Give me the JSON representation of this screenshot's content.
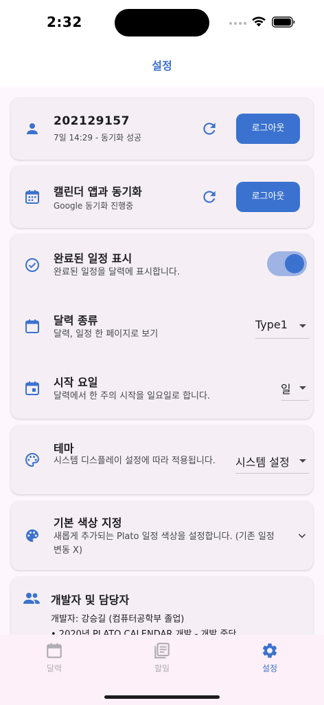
{
  "status_bar": {
    "time": "2:32"
  },
  "app_bar": {
    "title": "설정"
  },
  "account": {
    "id": "202129157",
    "sync_status": "7일 14:29 - 동기화 성공",
    "logout_label": "로그아웃",
    "icon": "person-icon"
  },
  "calendar_sync": {
    "title": "캘린더 앱과 동기화",
    "status": "Google 동기화 진행중",
    "logout_label": "로그아웃",
    "icon": "calendar-icon"
  },
  "settings": {
    "show_completed": {
      "title": "완료된 일정 표시",
      "desc": "완료된 일정을 달력에 표시합니다.",
      "enabled": true
    },
    "calendar_type": {
      "title": "달력 종류",
      "desc": "달력, 일정 한 페이지로 보기",
      "value": "Type1"
    },
    "start_day": {
      "title": "시작 요일",
      "desc": "달력에서 한 주의 시작을 일요일로 합니다.",
      "value": "일"
    }
  },
  "theme": {
    "title": "테마",
    "desc": "시스템 디스플레이 설정에 따라 적용됩니다.",
    "value": "시스템 설정"
  },
  "default_color": {
    "title": "기본 색상 지정",
    "desc": "새롭게 추가되는 Plato 일정 색상을 설정합니다. (기존 일정 변동 X)"
  },
  "developer": {
    "title": "개발자 및 담당자",
    "line1": "개발자: 강승길  (컴퓨터공학부 졸업)",
    "line2": "• 2020년 PLATO CALENDAR 개발 - 개발 중단"
  },
  "bottom_nav": {
    "items": [
      {
        "label": "달력",
        "icon": "calendar-icon",
        "active": false
      },
      {
        "label": "할일",
        "icon": "list-icon",
        "active": false
      },
      {
        "label": "설정",
        "icon": "gear-icon",
        "active": true
      }
    ]
  },
  "colors": {
    "accent": "#3b72cf",
    "card": "#f5eff5",
    "background": "#fdf7fd"
  }
}
